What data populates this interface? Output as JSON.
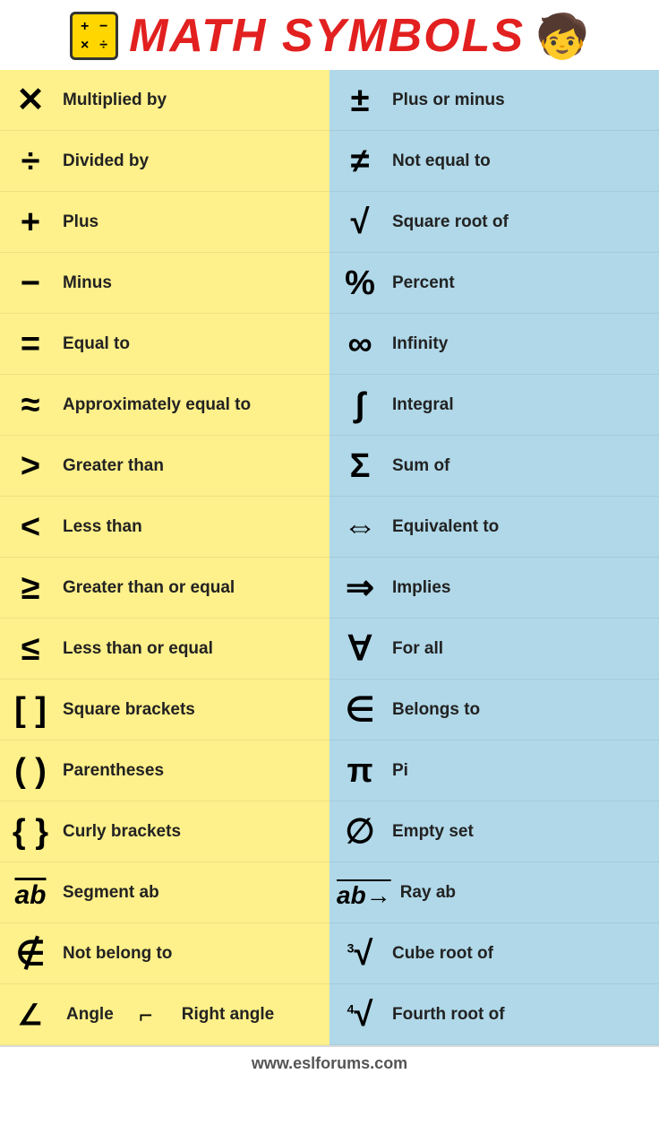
{
  "header": {
    "title": "MATH SYMBOLS",
    "footer": "www.eslforums.com"
  },
  "left_items": [
    {
      "symbol": "✕",
      "label": "Multiplied by"
    },
    {
      "symbol": "÷",
      "label": "Divided by"
    },
    {
      "symbol": "+",
      "label": "Plus"
    },
    {
      "symbol": "−",
      "label": "Minus"
    },
    {
      "symbol": "=",
      "label": "Equal to"
    },
    {
      "symbol": "≈",
      "label": "Approximately equal to"
    },
    {
      "symbol": ">",
      "label": "Greater than"
    },
    {
      "symbol": "<",
      "label": "Less than"
    },
    {
      "symbol": "≥",
      "label": "Greater than or equal"
    },
    {
      "symbol": "≤",
      "label": "Less than or equal"
    },
    {
      "symbol": "[ ]",
      "label": "Square brackets"
    },
    {
      "symbol": "( )",
      "label": "Parentheses"
    },
    {
      "symbol": "{ }",
      "label": "Curly brackets"
    },
    {
      "symbol": "ab_segment",
      "label": "Segment ab"
    },
    {
      "symbol": "∉",
      "label": "Not belong to"
    },
    {
      "symbol": "angle_right",
      "label": "Angle"
    }
  ],
  "right_items": [
    {
      "symbol": "±",
      "label": "Plus or minus"
    },
    {
      "symbol": "≠",
      "label": "Not equal to"
    },
    {
      "symbol": "√",
      "label": "Square root of"
    },
    {
      "symbol": "%",
      "label": "Percent"
    },
    {
      "symbol": "∞",
      "label": "Infinity"
    },
    {
      "symbol": "∫",
      "label": "Integral"
    },
    {
      "symbol": "Σ",
      "label": "Sum of"
    },
    {
      "symbol": "⇔",
      "label": "Equivalent to"
    },
    {
      "symbol": "⇒",
      "label": "Implies"
    },
    {
      "symbol": "∀",
      "label": "For all"
    },
    {
      "symbol": "∈",
      "label": "Belongs to"
    },
    {
      "symbol": "π",
      "label": "Pi"
    },
    {
      "symbol": "∅",
      "label": "Empty set"
    },
    {
      "symbol": "ab_ray",
      "label": "Ray ab"
    },
    {
      "symbol": "cube_root",
      "label": "Cube root of"
    },
    {
      "symbol": "fourth_root",
      "label": "Fourth root of"
    }
  ],
  "angle_label": "Angle",
  "right_angle_label": "Right angle"
}
